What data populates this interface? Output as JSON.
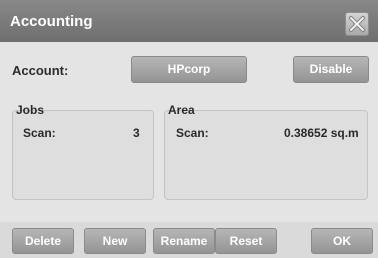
{
  "window": {
    "title": "Accounting"
  },
  "account": {
    "label": "Account:",
    "value": "HPcorp",
    "disable_label": "Disable"
  },
  "jobs": {
    "title": "Jobs",
    "scan_label": "Scan:",
    "scan_value": "3"
  },
  "area": {
    "title": "Area",
    "scan_label": "Scan:",
    "scan_value": "0.38652 sq.m"
  },
  "buttons": {
    "delete": "Delete",
    "new": "New",
    "rename": "Rename",
    "reset": "Reset",
    "ok": "OK"
  },
  "icons": {
    "close": "close-icon"
  },
  "colors": {
    "titlebar": "#7b7b7b",
    "button": "#a6a6a6",
    "background": "#e4e4e4"
  }
}
